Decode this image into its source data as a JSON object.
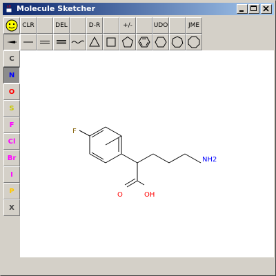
{
  "window": {
    "title": "Molecule Sketcher",
    "controls": [
      "minimize",
      "maximize",
      "close"
    ]
  },
  "toolbar": {
    "row1": [
      {
        "id": "smiley",
        "label": "",
        "icon": "smiley-icon"
      },
      {
        "id": "clr",
        "label": "CLR"
      },
      {
        "id": "blank1",
        "label": ""
      },
      {
        "id": "del",
        "label": "DEL"
      },
      {
        "id": "blank2",
        "label": ""
      },
      {
        "id": "dr",
        "label": "D-R"
      },
      {
        "id": "blank3",
        "label": ""
      },
      {
        "id": "plusminus",
        "label": "+/-"
      },
      {
        "id": "blank4",
        "label": ""
      },
      {
        "id": "udo",
        "label": "UDO"
      },
      {
        "id": "blank5",
        "label": ""
      },
      {
        "id": "jme",
        "label": "JME"
      }
    ],
    "row2": [
      {
        "id": "stereo-bond",
        "icon": "stereo-bond-icon"
      },
      {
        "id": "single-bond",
        "icon": "single-bond-icon"
      },
      {
        "id": "double-bond",
        "icon": "double-bond-icon"
      },
      {
        "id": "triple-bond",
        "icon": "triple-bond-icon"
      },
      {
        "id": "chain",
        "icon": "chain-icon"
      },
      {
        "id": "ring3",
        "icon": "triangle-ring-icon"
      },
      {
        "id": "ring4",
        "icon": "square-ring-icon"
      },
      {
        "id": "ring5",
        "icon": "pentagon-ring-icon"
      },
      {
        "id": "benzene",
        "icon": "benzene-ring-icon"
      },
      {
        "id": "ring6",
        "icon": "hexagon-ring-icon"
      },
      {
        "id": "ring7",
        "icon": "heptagon-ring-icon"
      },
      {
        "id": "ring8",
        "icon": "octagon-ring-icon"
      }
    ]
  },
  "atoms": [
    {
      "id": "C",
      "label": "C",
      "color": "#404040"
    },
    {
      "id": "N",
      "label": "N",
      "color": "#0000ff",
      "active": true
    },
    {
      "id": "O",
      "label": "O",
      "color": "#ff0000"
    },
    {
      "id": "S",
      "label": "S",
      "color": "#c8c800"
    },
    {
      "id": "F",
      "label": "F",
      "color": "#ff00ff"
    },
    {
      "id": "Cl",
      "label": "Cl",
      "color": "#ff00ff"
    },
    {
      "id": "Br",
      "label": "Br",
      "color": "#ff00ff"
    },
    {
      "id": "I",
      "label": "I",
      "color": "#ff00ff"
    },
    {
      "id": "P",
      "label": "P",
      "color": "#ffc800"
    },
    {
      "id": "X",
      "label": "X",
      "color": "#404040"
    }
  ],
  "molecule": {
    "labels": {
      "F": "F",
      "O": "O",
      "OH": "OH",
      "NH2": "NH2"
    },
    "colors": {
      "F": "#8b6914",
      "O": "#ff0000",
      "N": "#0000ff",
      "bond": "#000000"
    }
  },
  "colors": {
    "titlebar_start": "#0a246a",
    "titlebar_end": "#a6caf0",
    "face": "#d4d0c8",
    "canvas": "#ffffff"
  }
}
